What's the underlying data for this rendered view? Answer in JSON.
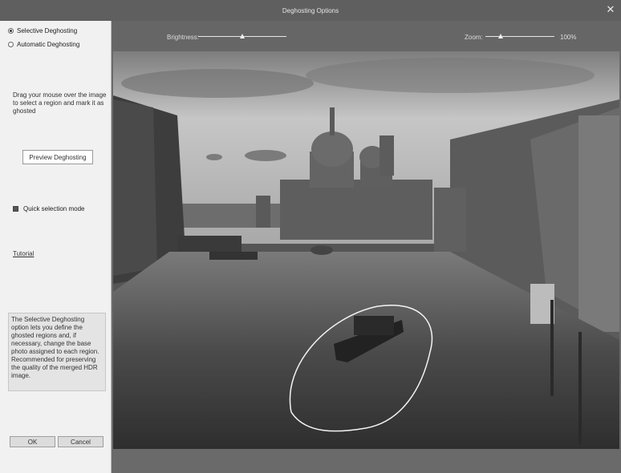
{
  "window": {
    "title": "Deghosting Options"
  },
  "sidebar": {
    "options": [
      {
        "label": "Selective Deghosting",
        "checked": true
      },
      {
        "label": "Automatic Deghosting",
        "checked": false
      }
    ],
    "instructions": "Drag your mouse over the image to select a region and mark it as ghosted",
    "preview_label": "Preview Deghosting",
    "quick_selection_label": "Quick selection mode",
    "quick_selection_checked": true,
    "tutorial_label": "Tutorial",
    "info_text": "The Selective Deghosting option lets you define the ghosted regions and, if necessary, change the base photo assigned to each region. Recommended for preserving the quality of the merged HDR image."
  },
  "footer": {
    "ok_label": "OK",
    "cancel_label": "Cancel"
  },
  "toolbar": {
    "brightness_label": "Brightness:",
    "brightness_level_percent": 50,
    "zoom_label": "Zoom:",
    "zoom_level_percent": 22,
    "zoom_value": "100%"
  },
  "colors": {
    "titlebar": "#5f5f5f",
    "sidebar": "#f1f1f1",
    "workspace": "#666666"
  },
  "icons": {
    "close": "close-icon"
  }
}
